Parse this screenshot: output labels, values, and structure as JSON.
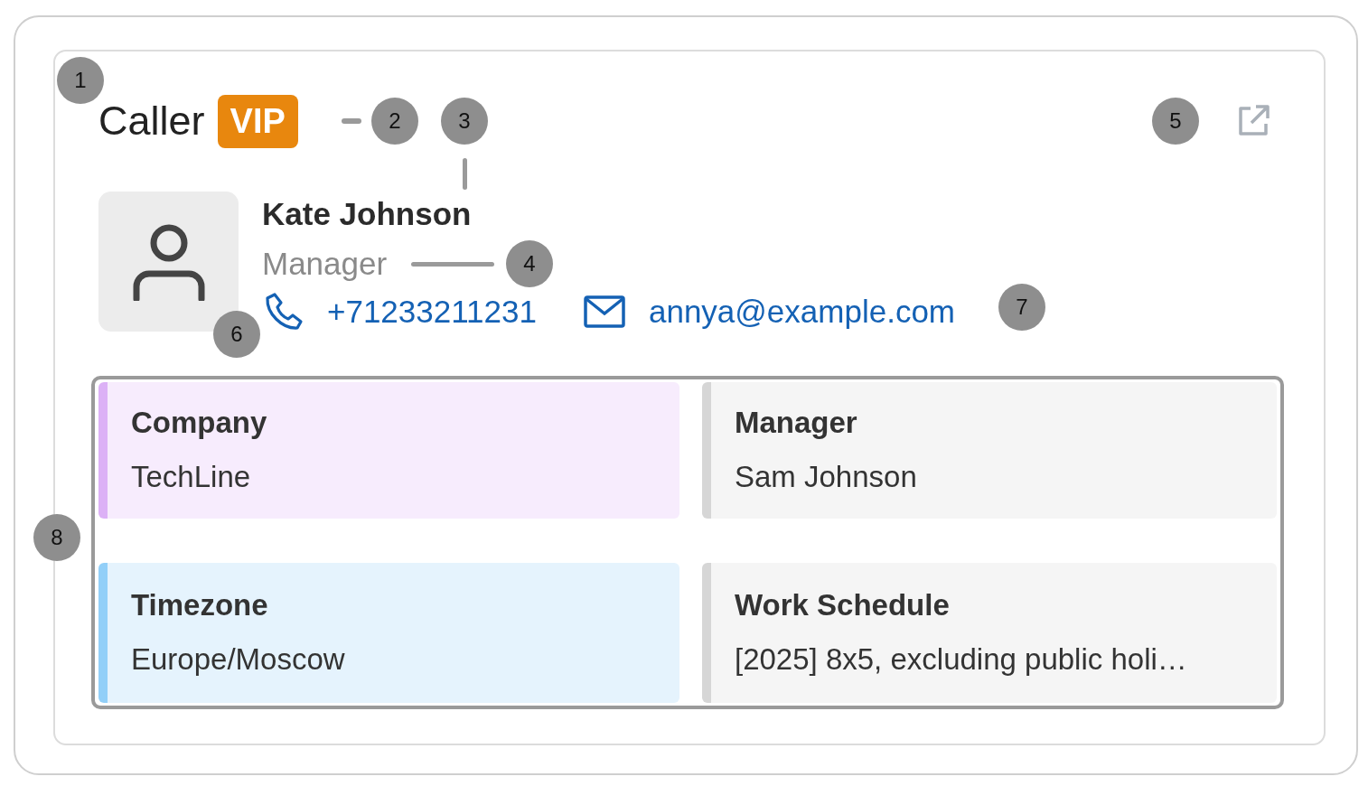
{
  "title": "Caller",
  "badge": "VIP",
  "contact": {
    "name": "Kate Johnson",
    "role": "Manager",
    "phone": "+71233211231",
    "email": "annya@example.com"
  },
  "fields": [
    {
      "label": "Company",
      "value": "TechLine",
      "color": "#dcb1f6"
    },
    {
      "label": "Manager",
      "value": "Sam Johnson",
      "color": "#d6d6d6"
    },
    {
      "label": "Timezone",
      "value": "Europe/Moscow",
      "color": "#92cff8"
    },
    {
      "label": "Work Schedule",
      "value": "[2025] 8x5, excluding public holi…",
      "color": "#d6d6d6"
    }
  ],
  "callouts": [
    "1",
    "2",
    "3",
    "4",
    "5",
    "6",
    "7",
    "8"
  ]
}
